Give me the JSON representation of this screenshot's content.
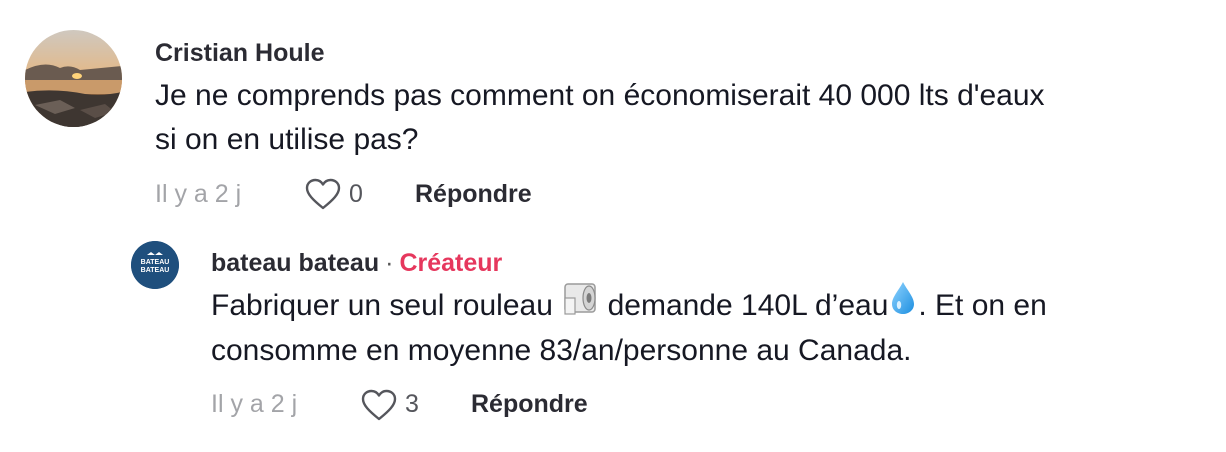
{
  "comments": [
    {
      "username": "Cristian Houle",
      "text_lines": [
        "Je ne comprends pas comment on économiserait 40 000 lts d'eaux",
        "si on en utilise pas?"
      ],
      "time": "Il y a 2 j",
      "likes": "0",
      "reply_label": "Répondre"
    },
    {
      "username": "bateau bateau",
      "separator": "·",
      "badge": "Créateur",
      "avatar_text_top": "BATEAU",
      "avatar_text_bottom": "BATEAU",
      "text_part1": "Fabriquer un seul rouleau",
      "text_part2": "demande 140L d’eau",
      "text_part3": ". Et on en",
      "text_line2": "consomme en moyenne 83/an/personne au Canada.",
      "time": "Il y a 2 j",
      "likes": "3",
      "reply_label": "Répondre"
    }
  ],
  "colors": {
    "creator_badge": "#e6375d",
    "avatar_brand": "#1f4f7d",
    "muted_text": "#a3a4a8"
  },
  "icons": {
    "like": "heart-outline-icon",
    "toilet_paper": "toilet-paper-emoji",
    "droplet": "droplet-emoji"
  }
}
